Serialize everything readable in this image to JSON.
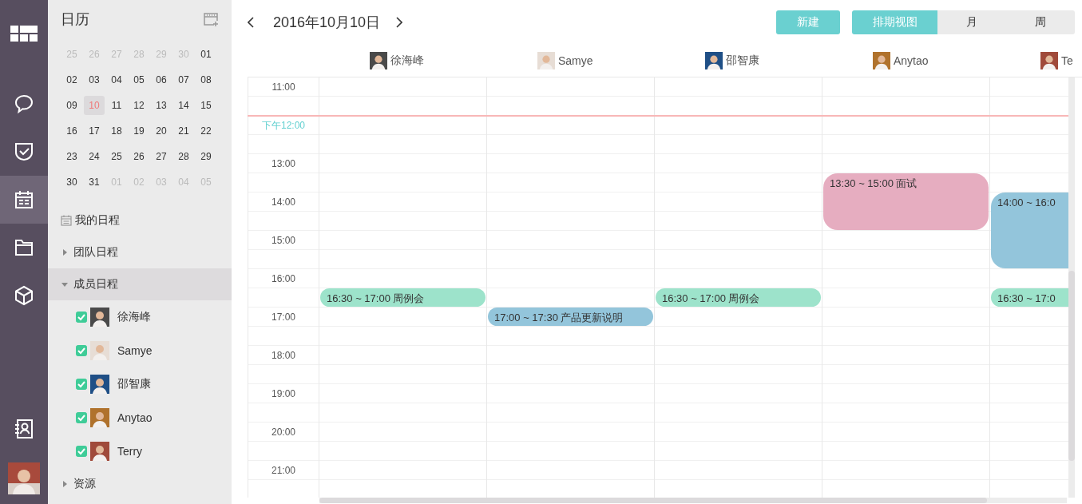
{
  "rail": [
    {
      "kind": "chat",
      "selected": false
    },
    {
      "kind": "tasks",
      "selected": false
    },
    {
      "kind": "calendar",
      "selected": true
    },
    {
      "kind": "folder",
      "selected": false
    },
    {
      "kind": "box",
      "selected": false
    }
  ],
  "rail_bottom": [
    {
      "kind": "contacts",
      "selected": false
    }
  ],
  "sidebar": {
    "title": "日历",
    "mini_calendar": [
      {
        "day": "25",
        "other_month": true,
        "selected": false
      },
      {
        "day": "26",
        "other_month": true,
        "selected": false
      },
      {
        "day": "27",
        "other_month": true,
        "selected": false
      },
      {
        "day": "28",
        "other_month": true,
        "selected": false
      },
      {
        "day": "29",
        "other_month": true,
        "selected": false
      },
      {
        "day": "30",
        "other_month": true,
        "selected": false
      },
      {
        "day": "01",
        "other_month": false,
        "selected": false
      },
      {
        "day": "02",
        "other_month": false,
        "selected": false
      },
      {
        "day": "03",
        "other_month": false,
        "selected": false
      },
      {
        "day": "04",
        "other_month": false,
        "selected": false
      },
      {
        "day": "05",
        "other_month": false,
        "selected": false
      },
      {
        "day": "06",
        "other_month": false,
        "selected": false
      },
      {
        "day": "07",
        "other_month": false,
        "selected": false
      },
      {
        "day": "08",
        "other_month": false,
        "selected": false
      },
      {
        "day": "09",
        "other_month": false,
        "selected": false
      },
      {
        "day": "10",
        "other_month": false,
        "selected": true
      },
      {
        "day": "11",
        "other_month": false,
        "selected": false
      },
      {
        "day": "12",
        "other_month": false,
        "selected": false
      },
      {
        "day": "13",
        "other_month": false,
        "selected": false
      },
      {
        "day": "14",
        "other_month": false,
        "selected": false
      },
      {
        "day": "15",
        "other_month": false,
        "selected": false
      },
      {
        "day": "16",
        "other_month": false,
        "selected": false
      },
      {
        "day": "17",
        "other_month": false,
        "selected": false
      },
      {
        "day": "18",
        "other_month": false,
        "selected": false
      },
      {
        "day": "19",
        "other_month": false,
        "selected": false
      },
      {
        "day": "20",
        "other_month": false,
        "selected": false
      },
      {
        "day": "21",
        "other_month": false,
        "selected": false
      },
      {
        "day": "22",
        "other_month": false,
        "selected": false
      },
      {
        "day": "23",
        "other_month": false,
        "selected": false
      },
      {
        "day": "24",
        "other_month": false,
        "selected": false
      },
      {
        "day": "25",
        "other_month": false,
        "selected": false
      },
      {
        "day": "26",
        "other_month": false,
        "selected": false
      },
      {
        "day": "27",
        "other_month": false,
        "selected": false
      },
      {
        "day": "28",
        "other_month": false,
        "selected": false
      },
      {
        "day": "29",
        "other_month": false,
        "selected": false
      },
      {
        "day": "30",
        "other_month": false,
        "selected": false
      },
      {
        "day": "31",
        "other_month": false,
        "selected": false
      },
      {
        "day": "01",
        "other_month": true,
        "selected": false
      },
      {
        "day": "02",
        "other_month": true,
        "selected": false
      },
      {
        "day": "03",
        "other_month": true,
        "selected": false
      },
      {
        "day": "04",
        "other_month": true,
        "selected": false
      },
      {
        "day": "05",
        "other_month": true,
        "selected": false
      }
    ],
    "sections": [
      {
        "kind": "calendar",
        "label": "我的日程",
        "selected": false
      },
      {
        "kind": "group",
        "label": "团队日程",
        "expanded": false,
        "selected": false
      },
      {
        "kind": "group",
        "label": "成员日程",
        "expanded": true,
        "selected": true,
        "children": [
          {
            "name": "徐海峰",
            "checked": true
          },
          {
            "name": "Samye",
            "checked": true
          },
          {
            "name": "邵智康",
            "checked": true
          },
          {
            "name": "Anytao",
            "checked": true
          },
          {
            "name": "Terry",
            "checked": true
          }
        ]
      },
      {
        "kind": "group",
        "label": "资源",
        "expanded": false,
        "selected": false
      }
    ]
  },
  "toolbar": {
    "date": "2016年10月10日",
    "new_button": "新建",
    "views": [
      {
        "label": "排期视图",
        "selected": true
      },
      {
        "label": "月",
        "selected": false
      },
      {
        "label": "周",
        "selected": false
      }
    ]
  },
  "hours": [
    {
      "label": "11:00",
      "current": false
    },
    {
      "label": "下午12:00",
      "current": true
    },
    {
      "label": "13:00",
      "current": false
    },
    {
      "label": "14:00",
      "current": false
    },
    {
      "label": "15:00",
      "current": false
    },
    {
      "label": "16:00",
      "current": false
    },
    {
      "label": "17:00",
      "current": false
    },
    {
      "label": "18:00",
      "current": false
    },
    {
      "label": "19:00",
      "current": false
    },
    {
      "label": "20:00",
      "current": false
    },
    {
      "label": "21:00",
      "current": false
    }
  ],
  "columns": [
    {
      "name": "徐海峰",
      "events": [
        {
          "label": "16:30 ~ 17:00 周例会",
          "color": "#9de3cb"
        }
      ]
    },
    {
      "name": "Samye",
      "events": [
        {
          "label": "17:00 ~ 17:30 产品更新说明",
          "color": "#93c5db"
        }
      ]
    },
    {
      "name": "邵智康",
      "events": [
        {
          "label": "16:30 ~ 17:00 周例会",
          "color": "#9de3cb"
        }
      ]
    },
    {
      "name": "Anytao",
      "events": [
        {
          "label": "13:30 ~ 15:00 面试",
          "color": "#e6adc0"
        }
      ]
    },
    {
      "name": "Te",
      "events": [
        {
          "label": "14:00 ~ 16:0",
          "color": "#93c5db"
        },
        {
          "label": "16:30 ~ 17:0",
          "color": "#9de3cb"
        }
      ]
    }
  ]
}
